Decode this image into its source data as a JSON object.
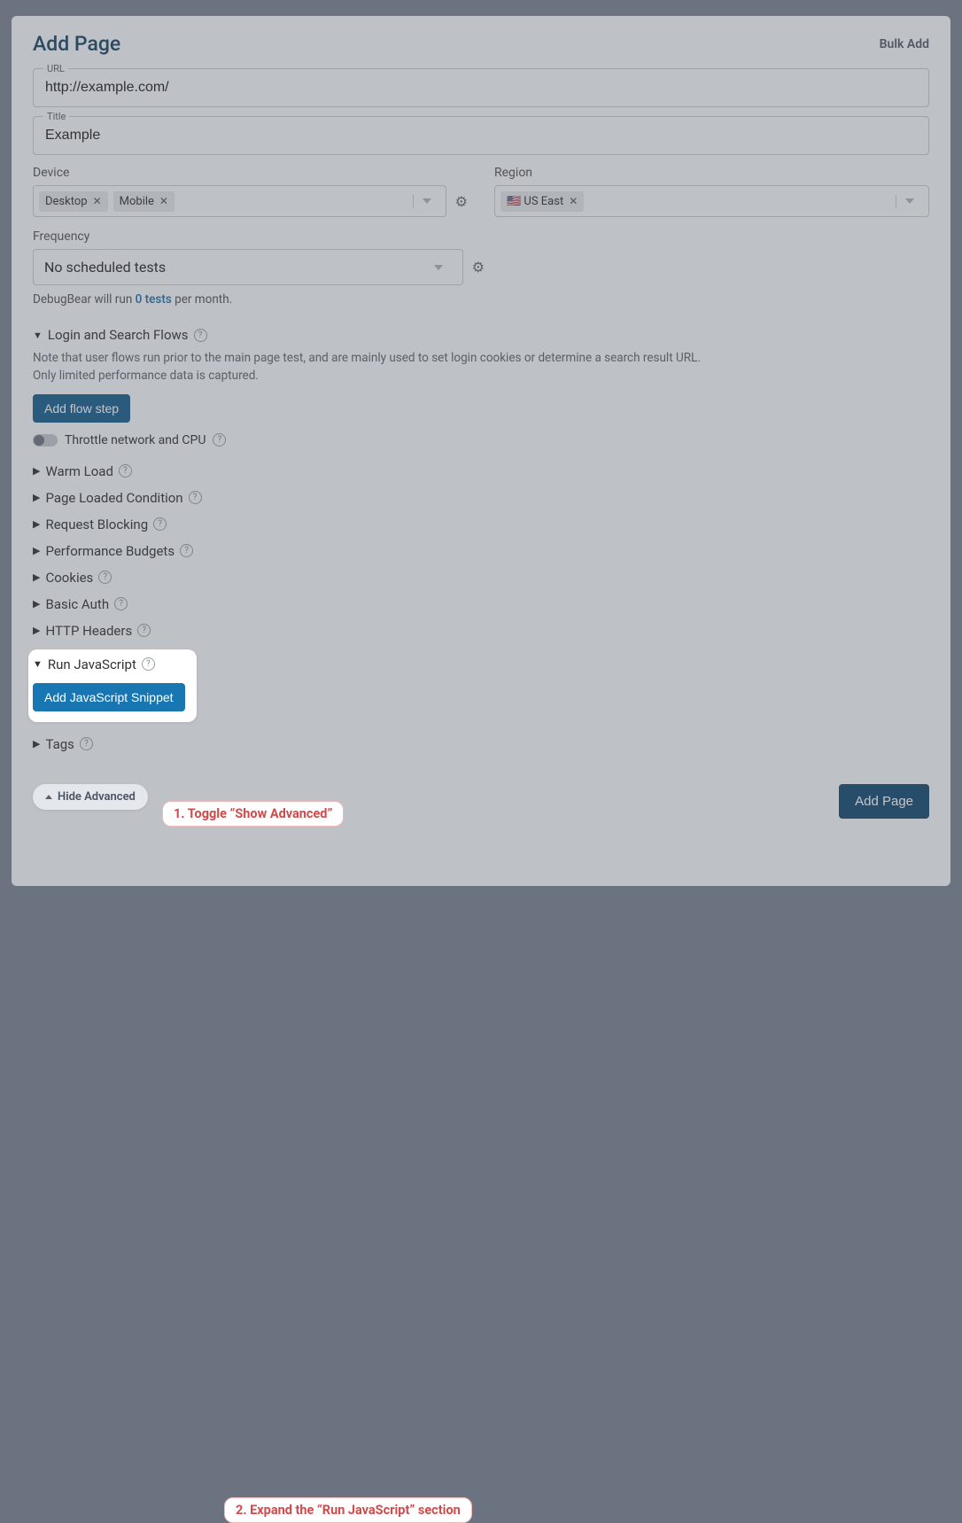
{
  "header": {
    "title": "Add Page",
    "bulk_add": "Bulk Add"
  },
  "fields": {
    "url_label": "URL",
    "url_value": "http://example.com/",
    "title_label": "Title",
    "title_value": "Example"
  },
  "device": {
    "label": "Device",
    "chips": [
      "Desktop",
      "Mobile"
    ]
  },
  "region": {
    "label": "Region",
    "chips": [
      "🇺🇸 US East"
    ]
  },
  "frequency": {
    "label": "Frequency",
    "value": "No scheduled tests"
  },
  "tests_hint": {
    "prefix": "DebugBear will run ",
    "count": "0 tests",
    "suffix": " per month."
  },
  "flows": {
    "title": "Login and Search Flows",
    "note1": "Note that user flows run prior to the main page test, and are mainly used to set login cookies or determine a search result URL.",
    "note2": "Only limited performance data is captured.",
    "add_button": "Add flow step",
    "throttle_label": "Throttle network and CPU"
  },
  "options": {
    "warm_load": "Warm Load",
    "page_loaded": "Page Loaded Condition",
    "request_blocking": "Request Blocking",
    "perf_budgets": "Performance Budgets",
    "cookies": "Cookies",
    "basic_auth": "Basic Auth",
    "http_headers": "HTTP Headers",
    "run_js": "Run JavaScript",
    "add_snippet": "Add JavaScript Snippet",
    "tags": "Tags"
  },
  "footer": {
    "hide_advanced": "Hide Advanced",
    "add_page": "Add Page"
  },
  "callouts": {
    "c1": "1. Toggle “Show Advanced”",
    "c2": "2. Expand the “Run JavaScript” section"
  }
}
